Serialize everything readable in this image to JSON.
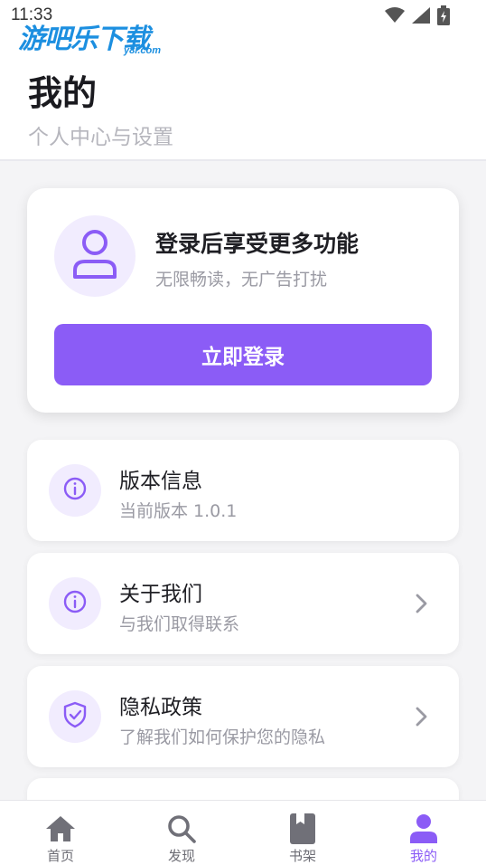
{
  "status_bar": {
    "time": "11:33",
    "icons": [
      "wifi-icon",
      "signal-icon",
      "battery-icon"
    ]
  },
  "watermark": {
    "text": "游吧乐下载",
    "sub": "y8l.com"
  },
  "header": {
    "title": "我的",
    "subtitle": "个人中心与设置"
  },
  "login_card": {
    "title": "登录后享受更多功能",
    "subtitle": "无限畅读，无广告打扰",
    "button_label": "立即登录",
    "icon": "user-icon"
  },
  "menu": [
    {
      "title": "版本信息",
      "subtitle": "当前版本 1.0.1",
      "icon": "info-icon",
      "has_chevron": false
    },
    {
      "title": "关于我们",
      "subtitle": "与我们取得联系",
      "icon": "info-icon",
      "has_chevron": true
    },
    {
      "title": "隐私政策",
      "subtitle": "了解我们如何保护您的隐私",
      "icon": "shield-check-icon",
      "has_chevron": true
    }
  ],
  "bottom_nav": [
    {
      "label": "首页",
      "icon": "home-icon",
      "active": false
    },
    {
      "label": "发现",
      "icon": "search-icon",
      "active": false
    },
    {
      "label": "书架",
      "icon": "book-icon",
      "active": false
    },
    {
      "label": "我的",
      "icon": "user-icon",
      "active": true
    }
  ],
  "colors": {
    "accent": "#8b5cf6",
    "accent_light": "#f1ecfe",
    "text_primary": "#1f1f24",
    "text_secondary": "#9a9aa3",
    "background": "#f4f4f6"
  }
}
